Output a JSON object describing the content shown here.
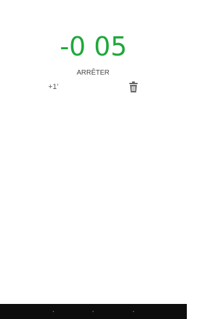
{
  "timer": {
    "display": "-0 05",
    "color": "#1fa83a"
  },
  "controls": {
    "stop_label": "ARRÊTER",
    "add_minute_label": "+1’",
    "delete_icon": "trash-icon"
  },
  "navbar": {
    "icons": [
      "back-icon",
      "home-icon",
      "recent-apps-icon"
    ]
  }
}
